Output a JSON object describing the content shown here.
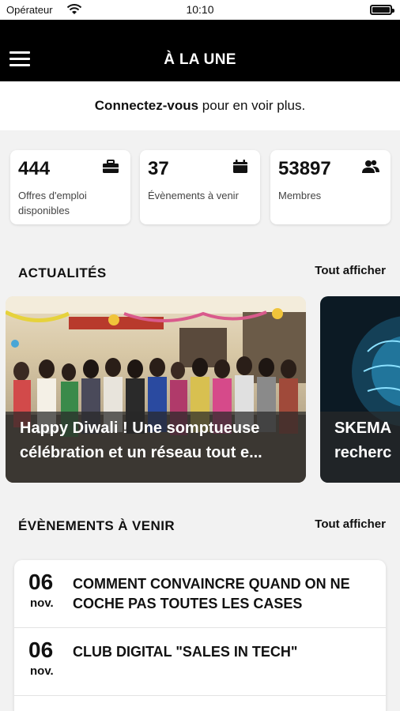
{
  "status_bar": {
    "carrier": "Opérateur",
    "time": "10:10"
  },
  "nav": {
    "title": "À LA UNE"
  },
  "login": {
    "bold": "Connectez-vous",
    "rest": " pour en voir plus."
  },
  "stats": [
    {
      "value": "444",
      "label": "Offres d'emploi disponibles",
      "icon": "briefcase-icon"
    },
    {
      "value": "37",
      "label": "Évènements à venir",
      "icon": "calendar-icon"
    },
    {
      "value": "53897",
      "label": "Membres",
      "icon": "users-icon"
    }
  ],
  "news": {
    "title": "ACTUALITÉS",
    "see_all": "Tout afficher",
    "items": [
      {
        "headline_line1": "Happy Diwali ! Une somptueuse",
        "headline_line2": "célébration et un réseau tout e..."
      },
      {
        "headline_line1": "SKEMA",
        "headline_line2": "recherc"
      }
    ]
  },
  "events": {
    "title": "ÉVÈNEMENTS À VENIR",
    "see_all": "Tout afficher",
    "items": [
      {
        "day": "06",
        "month": "nov.",
        "title": "COMMENT CONVAINCRE QUAND ON NE COCHE PAS TOUTES LES CASES"
      },
      {
        "day": "06",
        "month": "nov.",
        "title": "CLUB DIGITAL \"SALES IN TECH\""
      }
    ]
  }
}
